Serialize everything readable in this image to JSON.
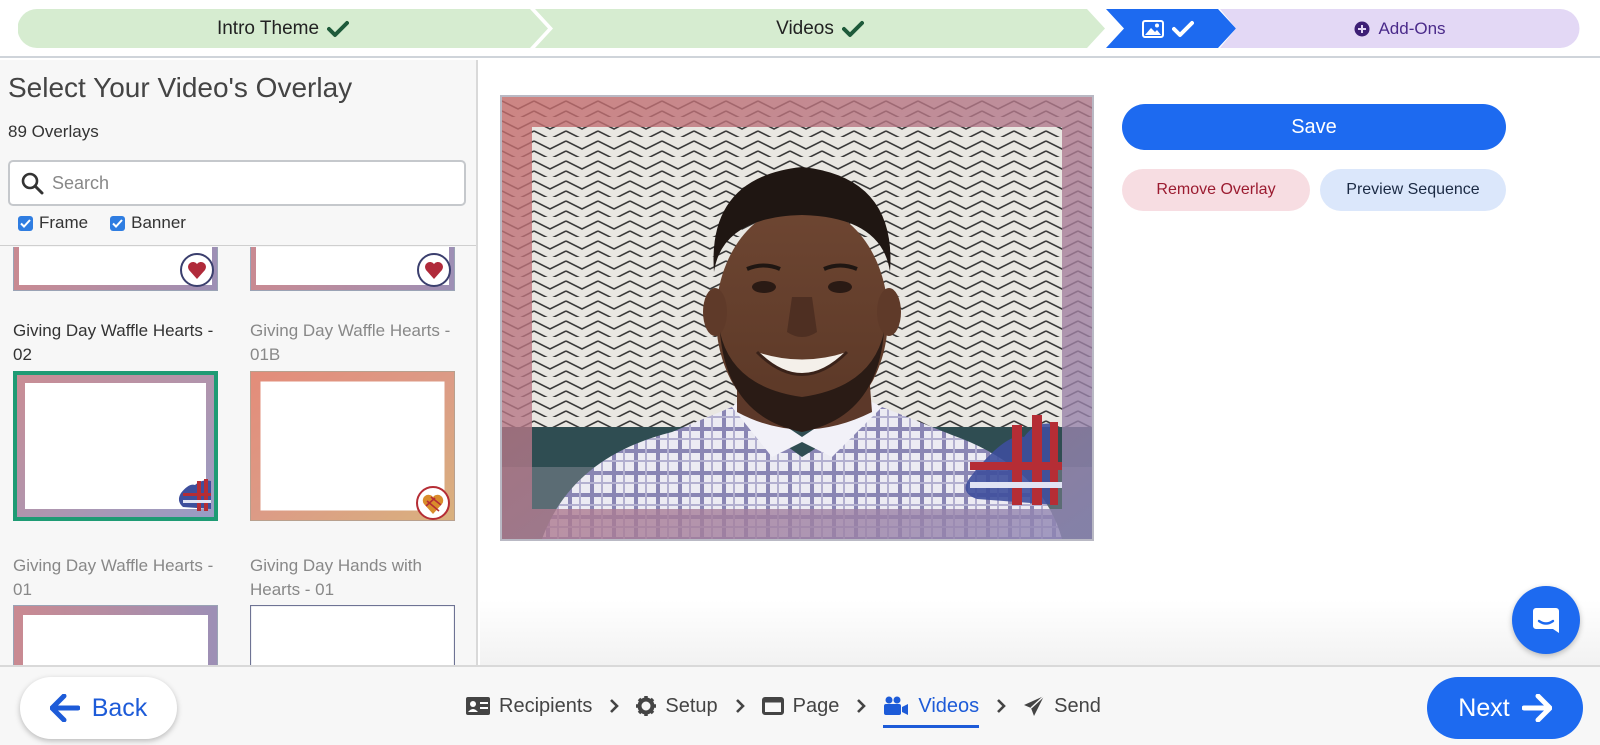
{
  "stepper": {
    "steps": [
      {
        "label": "Intro Theme",
        "status": "complete",
        "color": "#d6ecd0"
      },
      {
        "label": "Videos",
        "status": "complete",
        "color": "#d6ecd0"
      },
      {
        "label": "",
        "status": "current",
        "icon": "image-icon",
        "color": "#1d6af0"
      },
      {
        "label": "Add-Ons",
        "status": "upcoming",
        "icon": "plus-circle-icon",
        "color": "#e3d8f5"
      }
    ]
  },
  "overlay_panel": {
    "title": "Select Your Video's Overlay",
    "count": "89 Overlays",
    "search_placeholder": "Search",
    "filters": [
      {
        "label": "Frame",
        "checked": true
      },
      {
        "label": "Banner",
        "checked": true
      }
    ],
    "cards": [
      {
        "title": "",
        "selected": false,
        "badge": "heart-icon"
      },
      {
        "title": "",
        "selected": false,
        "badge": "heart-icon"
      },
      {
        "title": "Giving Day Waffle Hearts - 02",
        "selected": true,
        "badge": "waffle-heart-icon"
      },
      {
        "title": "Giving Day Waffle Hearts - 01B",
        "selected": false,
        "badge": "waffle-heart-badge-icon"
      },
      {
        "title": "Giving Day Waffle Hearts - 01",
        "selected": false
      },
      {
        "title": "Giving Day Hands with Hearts - 01",
        "selected": false
      }
    ]
  },
  "actions": {
    "save": "Save",
    "remove": "Remove Overlay",
    "preview": "Preview Sequence"
  },
  "bottom_nav": {
    "back": "Back",
    "next": "Next",
    "items": [
      {
        "label": "Recipients",
        "icon": "id-card-icon",
        "active": false
      },
      {
        "label": "Setup",
        "icon": "gear-icon",
        "active": false
      },
      {
        "label": "Page",
        "icon": "window-icon",
        "active": false
      },
      {
        "label": "Videos",
        "icon": "video-camera-icon",
        "active": true
      },
      {
        "label": "Send",
        "icon": "paper-plane-icon",
        "active": false
      }
    ]
  },
  "colors": {
    "primary": "#1d6af0",
    "complete_step": "#d6ecd0",
    "addons_step": "#e3d8f5",
    "selected_border": "#1e9b74",
    "remove_bg": "#f7dde2",
    "preview_bg": "#dbe7fb"
  }
}
